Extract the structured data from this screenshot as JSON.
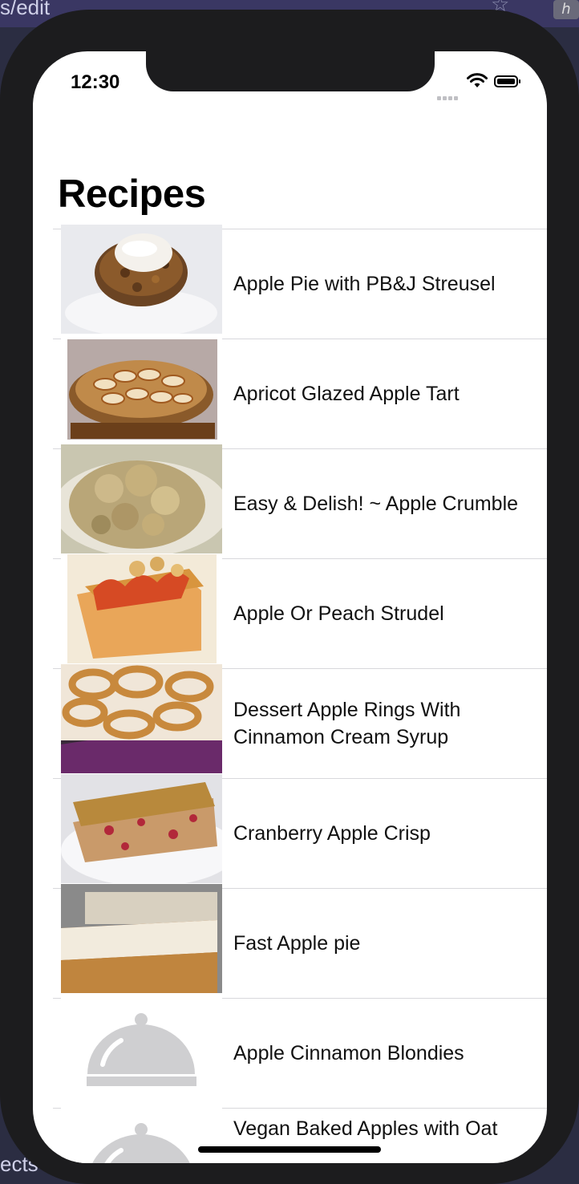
{
  "background": {
    "url_fragment": "s/edit",
    "bottom_fragment": "ects",
    "ext_icon": "ℎ"
  },
  "status_bar": {
    "time": "12:30"
  },
  "screen": {
    "title": "Recipes"
  },
  "recipes": [
    {
      "name": "Apple Pie with PB&J Streusel",
      "image": "photo-pie"
    },
    {
      "name": "Apricot Glazed Apple Tart",
      "image": "photo-tart"
    },
    {
      "name": "Easy & Delish! ~ Apple Crumble",
      "image": "photo-crumble"
    },
    {
      "name": "Apple Or Peach Strudel",
      "image": "photo-strudel"
    },
    {
      "name": "Dessert Apple Rings With Cinnamon Cream Syrup",
      "image": "photo-rings"
    },
    {
      "name": "Cranberry Apple Crisp",
      "image": "photo-crisp"
    },
    {
      "name": "Fast Apple pie",
      "image": "photo-bars"
    },
    {
      "name": "Apple Cinnamon Blondies",
      "image": "cloche-icon"
    },
    {
      "name": "Vegan Baked Apples with Oat",
      "image": "cloche-icon"
    }
  ]
}
